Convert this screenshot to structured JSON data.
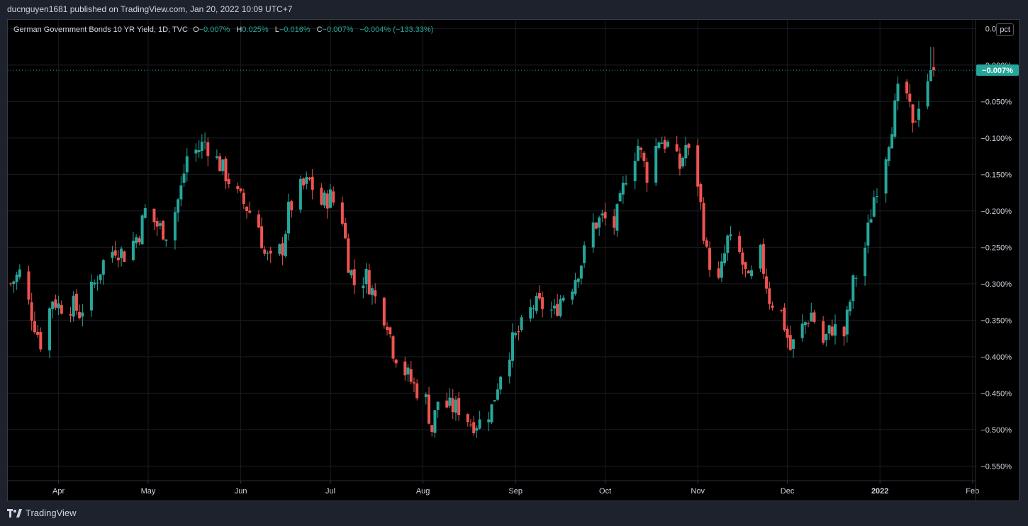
{
  "header": {
    "published": "ducnguyen1681 published on TradingView.com, Jan 20, 2022 10:09 UTC+7"
  },
  "legend": {
    "title": "German Government Bonds 10 YR Yield, 1D, TVC",
    "o_label": "O",
    "o_value": "−0.007%",
    "h_label": "H",
    "h_value": "0.025%",
    "l_label": "L",
    "l_value": "−0.016%",
    "c_label": "C",
    "c_value": "−0.007%",
    "change": "−0.004% (−133.33%)"
  },
  "scale_button": "pct",
  "footer": {
    "brand": "TradingView"
  },
  "colors": {
    "background": "#000000",
    "up": "#26a69a",
    "down": "#ef5350",
    "grid": "#1a1c22",
    "text": "#d1d4dc",
    "price_label_bg": "#26a69a"
  },
  "chart_data": {
    "type": "candlestick",
    "title": "German Government Bonds 10 YR Yield, 1D, TVC",
    "y_axis": {
      "min": -0.57,
      "max": 0.062,
      "ticks": [
        0.05,
        0.0,
        -0.05,
        -0.1,
        -0.15,
        -0.2,
        -0.25,
        -0.3,
        -0.35,
        -0.4,
        -0.45,
        -0.5,
        -0.55
      ],
      "tick_labels": [
        "0.050%",
        "0.000%",
        "−0.050%",
        "−0.100%",
        "−0.150%",
        "−0.200%",
        "−0.250%",
        "−0.300%",
        "−0.350%",
        "−0.400%",
        "−0.450%",
        "−0.500%",
        "−0.550%"
      ],
      "position": "right"
    },
    "x_axis": {
      "start": "2021-03-15",
      "end": "2022-02-02",
      "ticks": [
        {
          "date": "2021-04-01",
          "label": "Apr",
          "bold": false
        },
        {
          "date": "2021-05-01",
          "label": "May",
          "bold": false
        },
        {
          "date": "2021-06-01",
          "label": "Jun",
          "bold": false
        },
        {
          "date": "2021-07-01",
          "label": "Jul",
          "bold": false
        },
        {
          "date": "2021-08-01",
          "label": "Aug",
          "bold": false
        },
        {
          "date": "2021-09-01",
          "label": "Sep",
          "bold": false
        },
        {
          "date": "2021-10-01",
          "label": "Oct",
          "bold": false
        },
        {
          "date": "2021-11-01",
          "label": "Nov",
          "bold": false
        },
        {
          "date": "2021-12-01",
          "label": "Dec",
          "bold": false
        },
        {
          "date": "2022-01-01",
          "label": "2022",
          "bold": true
        },
        {
          "date": "2022-02-01",
          "label": "Feb",
          "bold": false
        }
      ]
    },
    "grid": true,
    "last_price": {
      "value": -0.007,
      "label": "−0.007%"
    },
    "close_series": [
      {
        "date": "2021-03-16",
        "close": -0.3
      },
      {
        "date": "2021-03-19",
        "close": -0.285
      },
      {
        "date": "2021-03-24",
        "close": -0.355
      },
      {
        "date": "2021-03-26",
        "close": -0.38
      },
      {
        "date": "2021-03-30",
        "close": -0.32
      },
      {
        "date": "2021-04-01",
        "close": -0.33
      },
      {
        "date": "2021-04-06",
        "close": -0.33
      },
      {
        "date": "2021-04-08",
        "close": -0.34
      },
      {
        "date": "2021-04-12",
        "close": -0.31
      },
      {
        "date": "2021-04-16",
        "close": -0.27
      },
      {
        "date": "2021-04-20",
        "close": -0.25
      },
      {
        "date": "2021-04-23",
        "close": -0.26
      },
      {
        "date": "2021-04-28",
        "close": -0.23
      },
      {
        "date": "2021-04-30",
        "close": -0.2
      },
      {
        "date": "2021-05-04",
        "close": -0.22
      },
      {
        "date": "2021-05-07",
        "close": -0.23
      },
      {
        "date": "2021-05-10",
        "close": -0.2
      },
      {
        "date": "2021-05-12",
        "close": -0.17
      },
      {
        "date": "2021-05-14",
        "close": -0.125
      },
      {
        "date": "2021-05-18",
        "close": -0.115
      },
      {
        "date": "2021-05-20",
        "close": -0.105
      },
      {
        "date": "2021-05-24",
        "close": -0.13
      },
      {
        "date": "2021-05-27",
        "close": -0.15
      },
      {
        "date": "2021-05-31",
        "close": -0.18
      },
      {
        "date": "2021-06-03",
        "close": -0.195
      },
      {
        "date": "2021-06-07",
        "close": -0.22
      },
      {
        "date": "2021-06-09",
        "close": -0.26
      },
      {
        "date": "2021-06-11",
        "close": -0.27
      },
      {
        "date": "2021-06-15",
        "close": -0.25
      },
      {
        "date": "2021-06-17",
        "close": -0.2
      },
      {
        "date": "2021-06-21",
        "close": -0.17
      },
      {
        "date": "2021-06-24",
        "close": -0.16
      },
      {
        "date": "2021-06-28",
        "close": -0.19
      },
      {
        "date": "2021-07-01",
        "close": -0.18
      },
      {
        "date": "2021-07-05",
        "close": -0.21
      },
      {
        "date": "2021-07-07",
        "close": -0.27
      },
      {
        "date": "2021-07-09",
        "close": -0.3
      },
      {
        "date": "2021-07-13",
        "close": -0.29
      },
      {
        "date": "2021-07-16",
        "close": -0.32
      },
      {
        "date": "2021-07-20",
        "close": -0.35
      },
      {
        "date": "2021-07-22",
        "close": -0.39
      },
      {
        "date": "2021-07-26",
        "close": -0.42
      },
      {
        "date": "2021-07-29",
        "close": -0.44
      },
      {
        "date": "2021-08-02",
        "close": -0.46
      },
      {
        "date": "2021-08-04",
        "close": -0.5
      },
      {
        "date": "2021-08-06",
        "close": -0.46
      },
      {
        "date": "2021-08-10",
        "close": -0.47
      },
      {
        "date": "2021-08-13",
        "close": -0.47
      },
      {
        "date": "2021-08-17",
        "close": -0.49
      },
      {
        "date": "2021-08-20",
        "close": -0.49
      },
      {
        "date": "2021-08-24",
        "close": -0.47
      },
      {
        "date": "2021-08-27",
        "close": -0.42
      },
      {
        "date": "2021-08-31",
        "close": -0.38
      },
      {
        "date": "2021-09-03",
        "close": -0.36
      },
      {
        "date": "2021-09-07",
        "close": -0.33
      },
      {
        "date": "2021-09-10",
        "close": -0.33
      },
      {
        "date": "2021-09-14",
        "close": -0.34
      },
      {
        "date": "2021-09-16",
        "close": -0.32
      },
      {
        "date": "2021-09-20",
        "close": -0.3
      },
      {
        "date": "2021-09-23",
        "close": -0.27
      },
      {
        "date": "2021-09-27",
        "close": -0.22
      },
      {
        "date": "2021-09-30",
        "close": -0.21
      },
      {
        "date": "2021-10-04",
        "close": -0.22
      },
      {
        "date": "2021-10-06",
        "close": -0.19
      },
      {
        "date": "2021-10-08",
        "close": -0.15
      },
      {
        "date": "2021-10-12",
        "close": -0.11
      },
      {
        "date": "2021-10-15",
        "close": -0.15
      },
      {
        "date": "2021-10-19",
        "close": -0.1
      },
      {
        "date": "2021-10-22",
        "close": -0.11
      },
      {
        "date": "2021-10-26",
        "close": -0.14
      },
      {
        "date": "2021-10-28",
        "close": -0.11
      },
      {
        "date": "2021-11-01",
        "close": -0.16
      },
      {
        "date": "2021-11-04",
        "close": -0.26
      },
      {
        "date": "2021-11-08",
        "close": -0.3
      },
      {
        "date": "2021-11-11",
        "close": -0.24
      },
      {
        "date": "2021-11-15",
        "close": -0.26
      },
      {
        "date": "2021-11-18",
        "close": -0.3
      },
      {
        "date": "2021-11-22",
        "close": -0.26
      },
      {
        "date": "2021-11-25",
        "close": -0.32
      },
      {
        "date": "2021-11-29",
        "close": -0.34
      },
      {
        "date": "2021-12-02",
        "close": -0.39
      },
      {
        "date": "2021-12-06",
        "close": -0.36
      },
      {
        "date": "2021-12-09",
        "close": -0.34
      },
      {
        "date": "2021-12-13",
        "close": -0.38
      },
      {
        "date": "2021-12-16",
        "close": -0.36
      },
      {
        "date": "2021-12-20",
        "close": -0.37
      },
      {
        "date": "2021-12-23",
        "close": -0.3
      },
      {
        "date": "2021-12-27",
        "close": -0.25
      },
      {
        "date": "2021-12-30",
        "close": -0.18
      },
      {
        "date": "2022-01-03",
        "close": -0.12
      },
      {
        "date": "2022-01-05",
        "close": -0.08
      },
      {
        "date": "2022-01-07",
        "close": -0.04
      },
      {
        "date": "2022-01-10",
        "close": -0.04
      },
      {
        "date": "2022-01-12",
        "close": -0.09
      },
      {
        "date": "2022-01-14",
        "close": -0.05
      },
      {
        "date": "2022-01-18",
        "close": -0.007
      }
    ]
  }
}
